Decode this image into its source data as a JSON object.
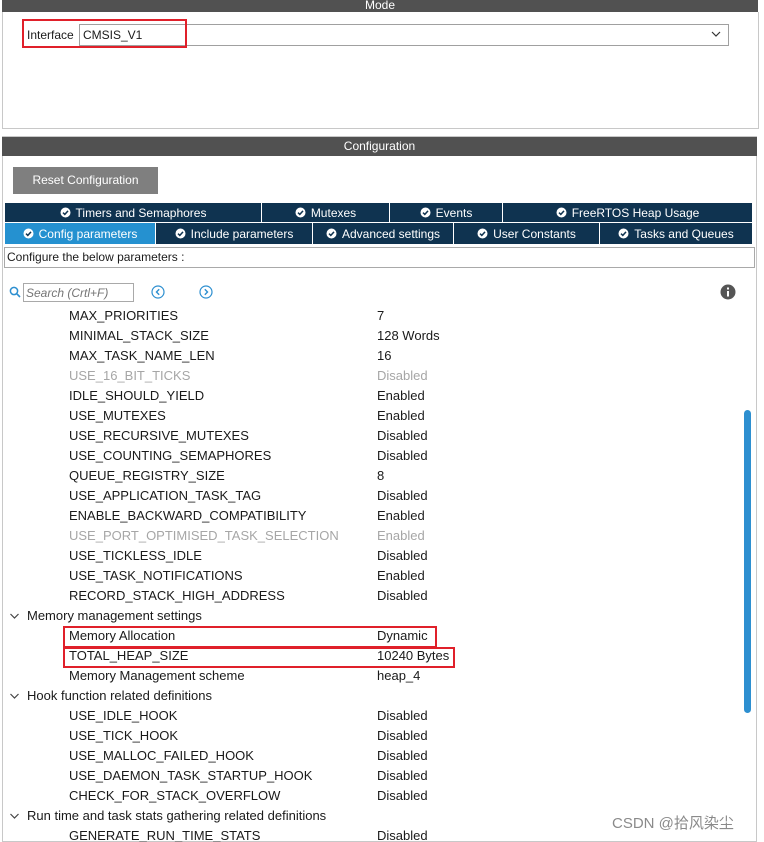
{
  "mode": {
    "header": "Mode",
    "interface_label": "Interface",
    "interface_value": "CMSIS_V1"
  },
  "configuration": {
    "header": "Configuration",
    "reset_label": "Reset Configuration",
    "tabs_row1": [
      {
        "label": "Timers and Semaphores",
        "icon": "check-circle-icon"
      },
      {
        "label": "Mutexes",
        "icon": "check-circle-icon"
      },
      {
        "label": "Events",
        "icon": "check-circle-icon"
      },
      {
        "label": "FreeRTOS Heap Usage",
        "icon": "check-circle-icon"
      }
    ],
    "tabs_row2": [
      {
        "label": "Config parameters",
        "icon": "check-circle-icon",
        "active": true
      },
      {
        "label": "Include parameters",
        "icon": "check-circle-icon"
      },
      {
        "label": "Advanced settings",
        "icon": "check-circle-icon"
      },
      {
        "label": "User Constants",
        "icon": "check-circle-icon"
      },
      {
        "label": "Tasks and Queues",
        "icon": "check-circle-icon"
      }
    ],
    "description": "Configure the below parameters :",
    "search_placeholder": "Search (Crtl+F)"
  },
  "params": [
    {
      "name": "MAX_PRIORITIES",
      "value": "7"
    },
    {
      "name": "MINIMAL_STACK_SIZE",
      "value": "128 Words"
    },
    {
      "name": "MAX_TASK_NAME_LEN",
      "value": "16"
    },
    {
      "name": "USE_16_BIT_TICKS",
      "value": "Disabled",
      "disabled": true
    },
    {
      "name": "IDLE_SHOULD_YIELD",
      "value": "Enabled"
    },
    {
      "name": "USE_MUTEXES",
      "value": "Enabled"
    },
    {
      "name": "USE_RECURSIVE_MUTEXES",
      "value": "Disabled"
    },
    {
      "name": "USE_COUNTING_SEMAPHORES",
      "value": "Disabled"
    },
    {
      "name": "QUEUE_REGISTRY_SIZE",
      "value": "8"
    },
    {
      "name": "USE_APPLICATION_TASK_TAG",
      "value": "Disabled"
    },
    {
      "name": "ENABLE_BACKWARD_COMPATIBILITY",
      "value": "Enabled"
    },
    {
      "name": "USE_PORT_OPTIMISED_TASK_SELECTION",
      "value": "Enabled",
      "disabled": true
    },
    {
      "name": "USE_TICKLESS_IDLE",
      "value": "Disabled"
    },
    {
      "name": "USE_TASK_NOTIFICATIONS",
      "value": "Enabled"
    },
    {
      "name": "RECORD_STACK_HIGH_ADDRESS",
      "value": "Disabled"
    },
    {
      "section": true,
      "name": "Memory management settings"
    },
    {
      "name": "Memory Allocation",
      "value": "Dynamic"
    },
    {
      "name": "TOTAL_HEAP_SIZE",
      "value": "10240 Bytes"
    },
    {
      "name": "Memory Management scheme",
      "value": "heap_4"
    },
    {
      "section": true,
      "name": "Hook function related definitions"
    },
    {
      "name": "USE_IDLE_HOOK",
      "value": "Disabled"
    },
    {
      "name": "USE_TICK_HOOK",
      "value": "Disabled"
    },
    {
      "name": "USE_MALLOC_FAILED_HOOK",
      "value": "Disabled"
    },
    {
      "name": "USE_DAEMON_TASK_STARTUP_HOOK",
      "value": "Disabled"
    },
    {
      "name": "CHECK_FOR_STACK_OVERFLOW",
      "value": "Disabled"
    },
    {
      "section": true,
      "name": "Run time and task stats gathering related definitions"
    },
    {
      "name": "GENERATE_RUN_TIME_STATS",
      "value": "Disabled"
    }
  ],
  "watermark": "CSDN @拾风染尘",
  "colors": {
    "header_bg": "#515151",
    "tab_bg": "#0f3350",
    "tab_active_bg": "#2591d0",
    "highlight": "#e0202a",
    "scrollbar": "#2d8fd0"
  }
}
